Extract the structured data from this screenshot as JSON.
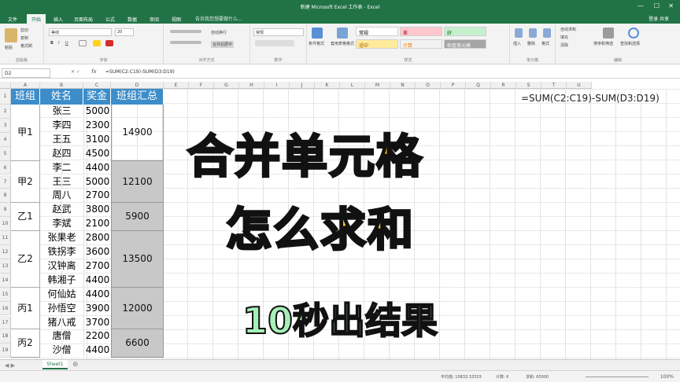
{
  "title_bar": {
    "title": "新建 Microsoft Excel 工作表 - Excel",
    "min": "—",
    "max": "☐",
    "close": "✕"
  },
  "ribbon_tabs": [
    {
      "label": "文件"
    },
    {
      "label": "开始"
    },
    {
      "label": "插入"
    },
    {
      "label": "页面布局"
    },
    {
      "label": "公式"
    },
    {
      "label": "数据"
    },
    {
      "label": "审阅"
    },
    {
      "label": "视图"
    }
  ],
  "tell_me": "告诉我您想要做什么...",
  "user_area": "登录  共享",
  "ribbon": {
    "clipboard": {
      "paste": "粘贴",
      "cut": "剪切",
      "copy": "复制",
      "format_painter": "格式刷",
      "group": "剪贴板"
    },
    "font": {
      "name": "等线",
      "size": "20",
      "group": "字体",
      "bold": "B",
      "italic": "I",
      "underline": "U"
    },
    "alignment": {
      "wrap": "自动换行",
      "merge": "合并后居中",
      "group": "对齐方式"
    },
    "number": {
      "format": "常规",
      "group": "数字"
    },
    "styles": {
      "conditional": "条件格式",
      "as_table": "套用表格格式",
      "normal": "常规",
      "bad": "差",
      "good": "好",
      "neutral": "适中",
      "calc": "计算",
      "check": "检查单元格",
      "group": "样式"
    },
    "cells": {
      "insert": "插入",
      "delete": "删除",
      "format": "格式",
      "group": "单元格"
    },
    "editing": {
      "autosum": "自动求和",
      "fill": "填充",
      "clear": "清除",
      "sort": "排序和筛选",
      "find": "查找和选择",
      "group": "编辑"
    }
  },
  "formula_bar": {
    "name_box": "D2",
    "formula": "=SUM(C2:C19)-SUM(D3:D19)"
  },
  "columns": [
    "A",
    "B",
    "C",
    "D",
    "E",
    "F",
    "G",
    "H",
    "I",
    "J",
    "K",
    "L",
    "M",
    "N",
    "O",
    "P",
    "Q",
    "R",
    "S",
    "T",
    "U"
  ],
  "rows": [
    "1",
    "2",
    "3",
    "4",
    "5",
    "6",
    "7",
    "8",
    "9",
    "10",
    "11",
    "12",
    "13",
    "14",
    "15",
    "16",
    "17",
    "18",
    "19"
  ],
  "table": {
    "headers": [
      "班组",
      "姓名",
      "奖金",
      "班组汇总"
    ],
    "groups": [
      {
        "label": "甲1",
        "total": "14900",
        "members": [
          [
            "张三",
            "5000"
          ],
          [
            "李四",
            "2300"
          ],
          [
            "王五",
            "3100"
          ],
          [
            "赵四",
            "4500"
          ]
        ]
      },
      {
        "label": "甲2",
        "total": "12100",
        "members": [
          [
            "李二",
            "4400"
          ],
          [
            "王三",
            "5000"
          ],
          [
            "周八",
            "2700"
          ]
        ]
      },
      {
        "label": "乙1",
        "total": "5900",
        "members": [
          [
            "赵武",
            "3800"
          ],
          [
            "李斌",
            "2100"
          ]
        ]
      },
      {
        "label": "乙2",
        "total": "13500",
        "members": [
          [
            "张果老",
            "2800"
          ],
          [
            "铁拐李",
            "3600"
          ],
          [
            "汉钟离",
            "2700"
          ],
          [
            "韩湘子",
            "4400"
          ]
        ]
      },
      {
        "label": "丙1",
        "total": "12000",
        "members": [
          [
            "何仙姑",
            "4400"
          ],
          [
            "孙悟空",
            "3900"
          ],
          [
            "猪八戒",
            "3700"
          ]
        ]
      },
      {
        "label": "丙2",
        "total": "6600",
        "members": [
          [
            "唐僧",
            "2200"
          ],
          [
            "沙僧",
            "4400"
          ]
        ]
      }
    ]
  },
  "side_formula": "=SUM(C2:C19)-SUM(D3:D19)",
  "overlay": {
    "line1": "合并单元格",
    "line2": "怎么求和",
    "line3": "10秒出结果"
  },
  "sheet_tab": "Sheet1",
  "status": {
    "average": "平均值: 10833.33333",
    "count": "计数: 6",
    "sum": "求和: 65000",
    "zoom": "100%"
  },
  "colors": {
    "excel_green": "#217346",
    "header_blue": "#3c8dc9",
    "title_yellow": "#ffd21f",
    "subtitle_green": "#a6f0b8"
  }
}
